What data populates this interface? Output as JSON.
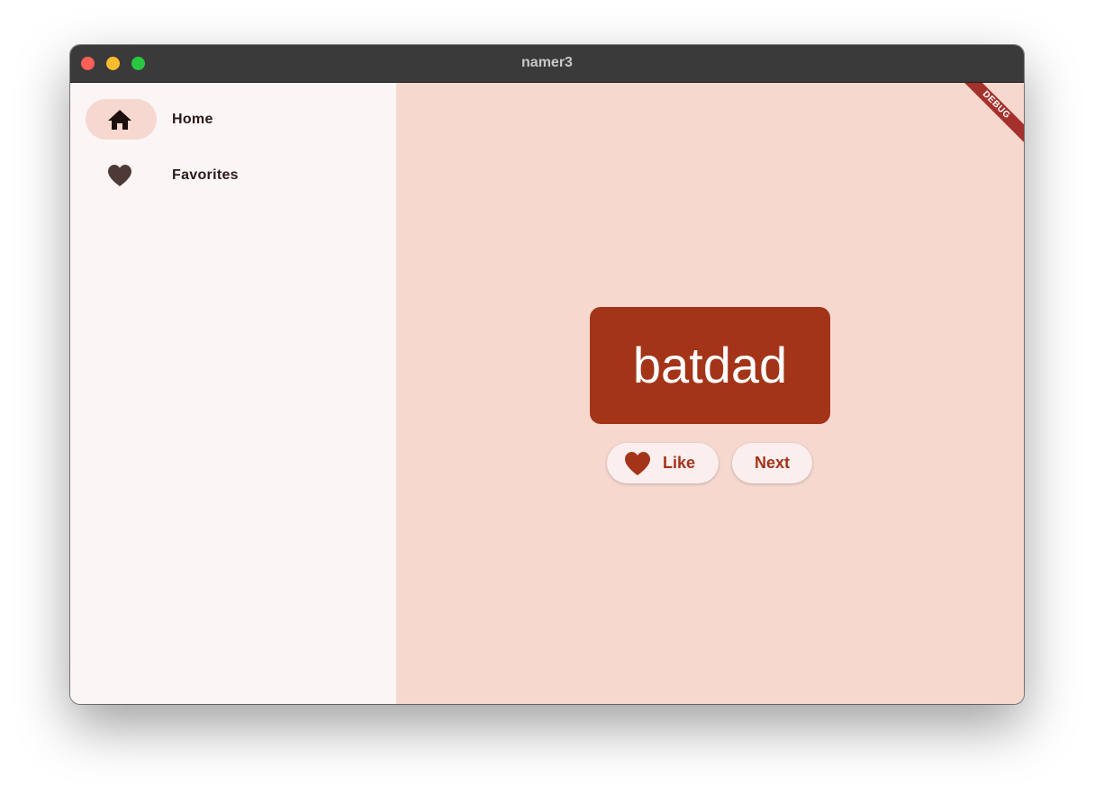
{
  "window": {
    "title": "namer3"
  },
  "sidebar": {
    "items": [
      {
        "label": "Home",
        "icon": "home-icon",
        "selected": true
      },
      {
        "label": "Favorites",
        "icon": "heart-icon",
        "selected": false
      }
    ]
  },
  "main": {
    "debug_banner": "DEBUG",
    "word": "batdad",
    "like_label": "Like",
    "next_label": "Next"
  },
  "colors": {
    "titlebar": "#3a3a3a",
    "sidebar_bg": "#fcf5f6",
    "main_bg": "#f6d8cf",
    "accent": "#a33418",
    "nav_indicator": "#f6d8d0",
    "button_bg": "#fbeeee",
    "debug_banner": "#a4312b"
  }
}
